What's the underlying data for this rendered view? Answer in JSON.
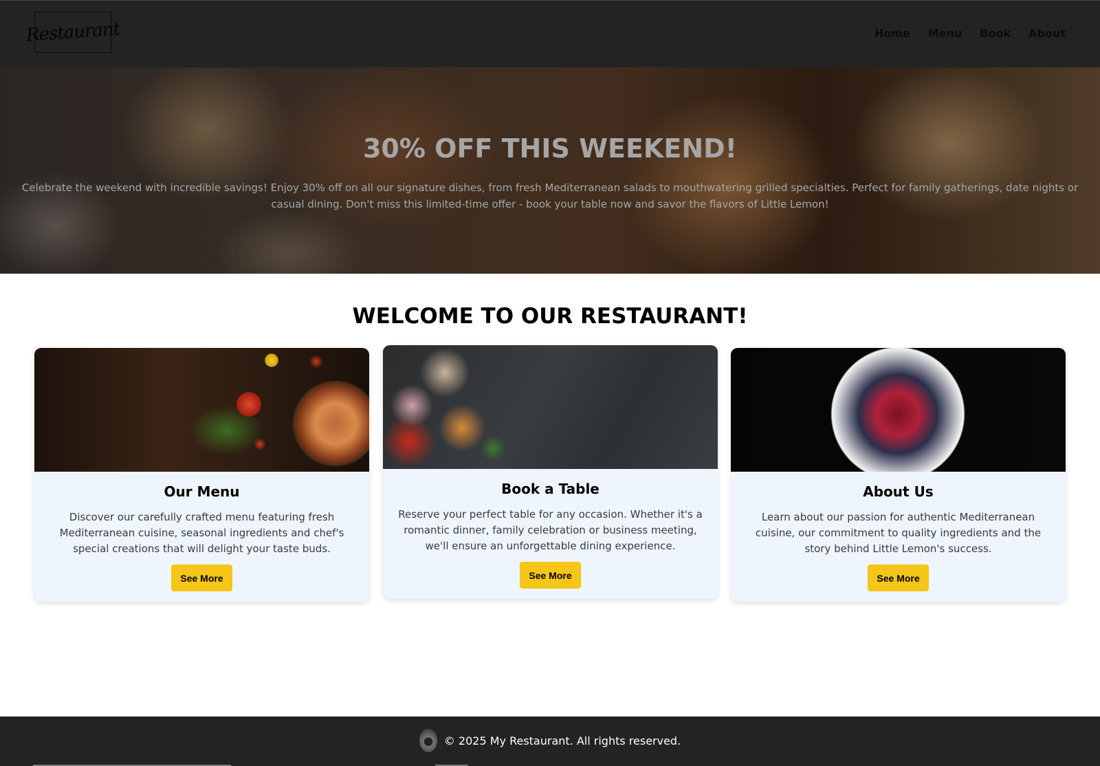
{
  "header": {
    "logo_text": "Restaurant",
    "nav": [
      {
        "label": "Home"
      },
      {
        "label": "Menu"
      },
      {
        "label": "Book"
      },
      {
        "label": "About"
      }
    ]
  },
  "hero": {
    "title": "30% OFF THIS WEEKEND!",
    "text": "Celebrate the weekend with incredible savings! Enjoy 30% off on all our signature dishes, from fresh Mediterranean salads to mouthwatering grilled specialties. Perfect for family gatherings, date nights or casual dining. Don't miss this limited-time offer - book your table now and savor the flavors of Little Lemon!"
  },
  "welcome": {
    "title": "WELCOME TO OUR RESTAURANT!"
  },
  "cards": [
    {
      "title": "Our Menu",
      "text": "Discover our carefully crafted menu featuring fresh Mediterranean cuisine, seasonal ingredients and chef's special creations that will delight your taste buds.",
      "button": "See More"
    },
    {
      "title": "Book a Table",
      "text": "Reserve your perfect table for any occasion. Whether it's a romantic dinner, family celebration or business meeting, we'll ensure an unforgettable dining experience.",
      "button": "See More"
    },
    {
      "title": "About Us",
      "text": "Learn about our passion for authentic Mediterranean cuisine, our commitment to quality ingredients and the story behind Little Lemon's success.",
      "button": "See More"
    }
  ],
  "footer": {
    "text": "© 2025 My Restaurant. All rights reserved."
  },
  "colors": {
    "header_bg": "#232323",
    "accent_button": "#f5c518",
    "card_bg": "#eef5fc"
  }
}
